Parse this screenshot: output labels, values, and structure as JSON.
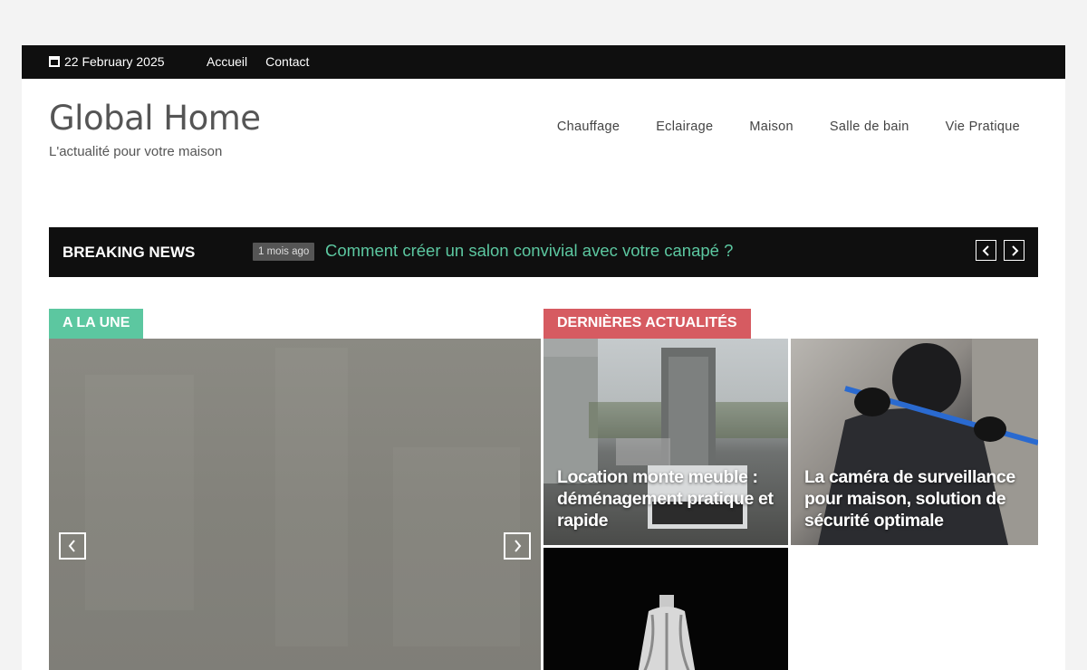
{
  "topbar": {
    "date": "22 February 2025",
    "links": [
      "Accueil",
      "Contact"
    ]
  },
  "brand": {
    "title": "Global Home",
    "tagline": "L'actualité pour votre maison"
  },
  "nav": {
    "items": [
      "Chauffage",
      "Eclairage",
      "Maison",
      "Salle de bain",
      "Vie Pratique"
    ]
  },
  "breaking": {
    "label": "BREAKING NEWS",
    "ago": "1 mois ago",
    "headline": "Comment créer un salon convivial avec votre canapé ?"
  },
  "sections": {
    "featured_tag": "A LA UNE",
    "latest_tag": "DERNIÈRES ACTUALITÉS"
  },
  "latest": {
    "items": [
      {
        "title": "Location monte meuble : déménagement pratique et rapide"
      },
      {
        "title": "La caméra de surveillance pour maison, solution de sécurité optimale"
      },
      {
        "title": ""
      }
    ]
  },
  "colors": {
    "accent_green": "#5cc7a0",
    "accent_red": "#d65b61",
    "dark_bar": "#0f0f0f"
  }
}
